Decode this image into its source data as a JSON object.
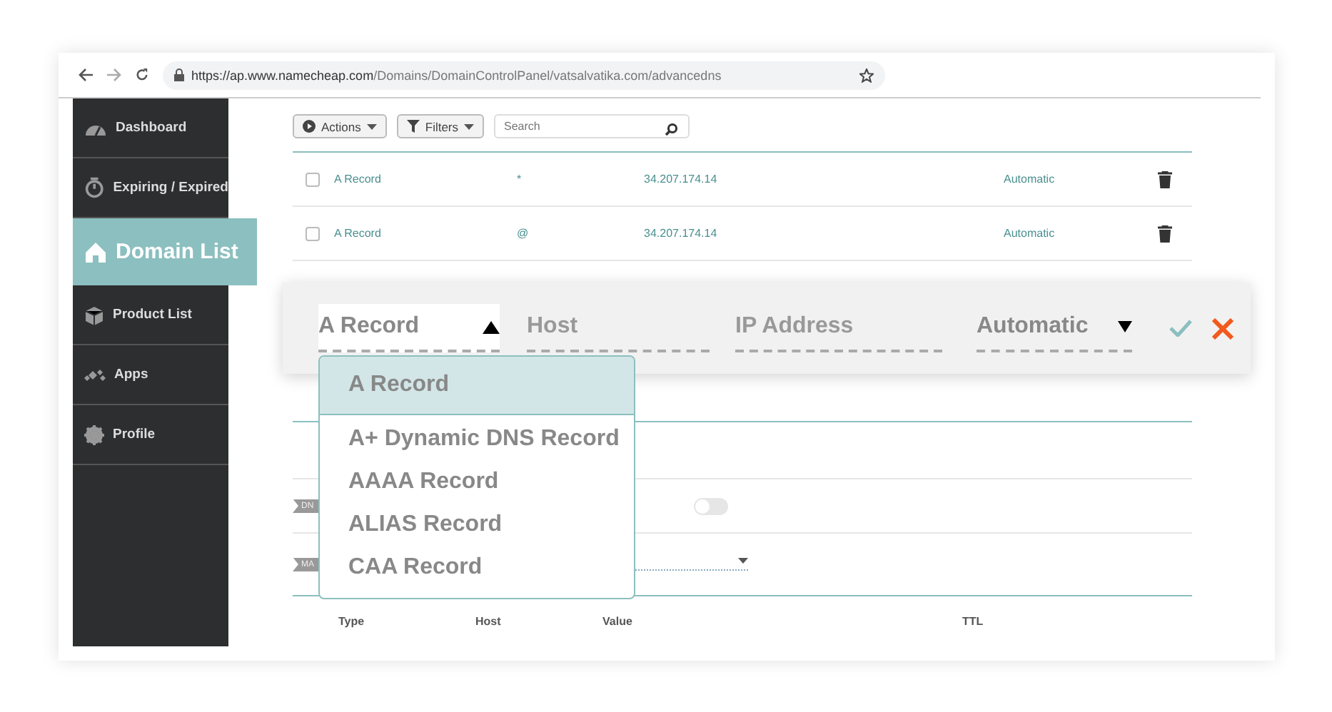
{
  "browser": {
    "url_host": "https://ap.www.namecheap.com",
    "url_path": "/Domains/DomainControlPanel/vatsalvatika.com/advancedns"
  },
  "sidebar": {
    "items": [
      {
        "label": "Dashboard",
        "selected": false
      },
      {
        "label": "Expiring / Expired",
        "selected": false
      },
      {
        "label": "Domain List",
        "selected": true
      },
      {
        "label": "Product List",
        "selected": false
      },
      {
        "label": "Apps",
        "selected": false
      },
      {
        "label": "Profile",
        "selected": false
      }
    ]
  },
  "toolbar": {
    "actions": "Actions",
    "filters": "Filters",
    "search_placeholder": "Search"
  },
  "records": [
    {
      "type": "A Record",
      "host": "*",
      "value": "34.207.174.14",
      "ttl": "Automatic",
      "checked": false
    },
    {
      "type": "A Record",
      "host": "@",
      "value": "34.207.174.14",
      "ttl": "Automatic",
      "checked": false
    }
  ],
  "edit_row": {
    "type": "A Record",
    "host_placeholder": "Host",
    "value_placeholder": "IP Address",
    "ttl": "Automatic"
  },
  "type_dropdown": {
    "expanded": true,
    "options": [
      {
        "label": "A Record",
        "selected": true
      },
      {
        "label": "A+ Dynamic DNS Record",
        "selected": false
      },
      {
        "label": "AAAA Record",
        "selected": false
      },
      {
        "label": "ALIAS Record",
        "selected": false
      },
      {
        "label": "CAA Record",
        "selected": false
      }
    ]
  },
  "sections": [
    {
      "tag": "DN",
      "kind": "toggle",
      "on": false
    },
    {
      "tag": "MA",
      "kind": "select"
    }
  ],
  "table_header": [
    "Type",
    "Host",
    "Value",
    "TTL"
  ]
}
